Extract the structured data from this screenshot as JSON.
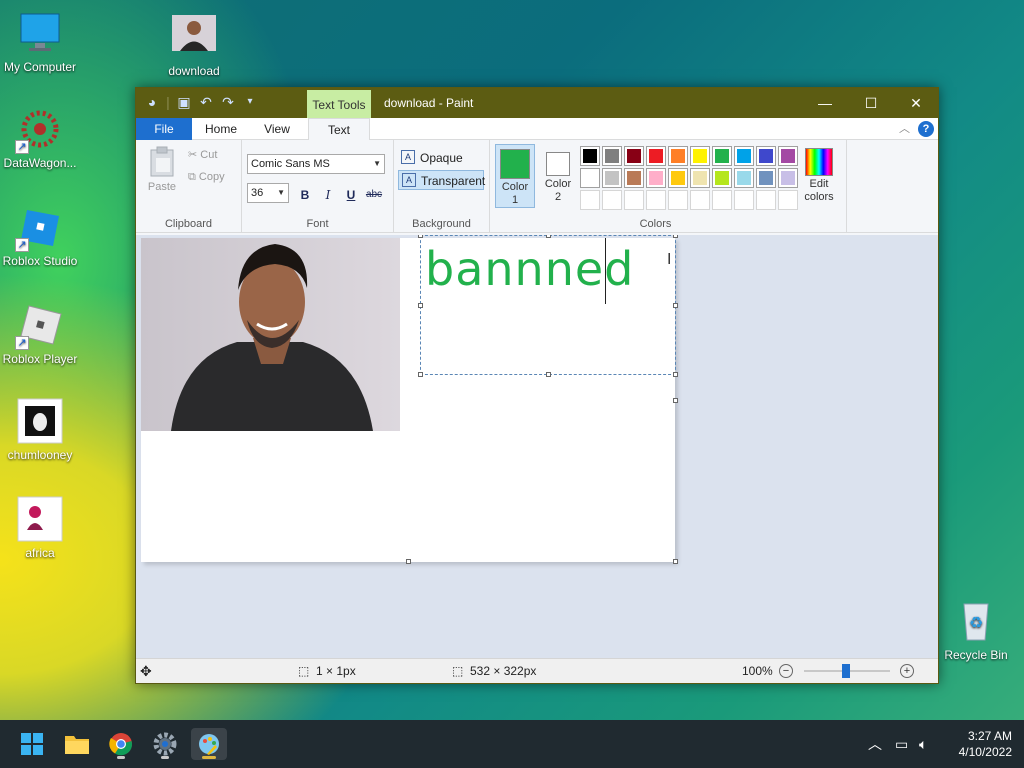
{
  "desktop": {
    "icons": [
      {
        "label": "My Computer"
      },
      {
        "label": "download"
      },
      {
        "label": "DataWagon..."
      },
      {
        "label": "Roblox Studio"
      },
      {
        "label": "Roblox Player"
      },
      {
        "label": "chumlooney"
      },
      {
        "label": "africa"
      },
      {
        "label": "Recycle Bin"
      }
    ]
  },
  "window": {
    "title": "download - Paint",
    "context_tab": "Text Tools",
    "tabs": [
      "File",
      "Home",
      "View",
      "Text"
    ],
    "active_tab": "Text"
  },
  "ribbon": {
    "clipboard": {
      "label": "Clipboard",
      "paste": "Paste",
      "cut": "Cut",
      "copy": "Copy"
    },
    "font": {
      "label": "Font",
      "family": "Comic Sans MS",
      "size": "36",
      "bold": "B",
      "italic": "I",
      "underline": "U",
      "strike": "abc"
    },
    "background": {
      "label": "Background",
      "opaque": "Opaque",
      "transparent": "Transparent",
      "selected": "Transparent"
    },
    "colors": {
      "label": "Colors",
      "color1_label": "Color 1",
      "color2_label": "Color 2",
      "color1": "#22b14c",
      "color2": "#ffffff",
      "edit_colors": "Edit colors",
      "palette_row1": [
        "#000000",
        "#7f7f7f",
        "#880015",
        "#ed1c24",
        "#ff7f27",
        "#fff200",
        "#22b14c",
        "#00a2e8",
        "#3f48cc",
        "#a349a4"
      ],
      "palette_row2": [
        "#ffffff",
        "#c3c3c3",
        "#b97a57",
        "#ffaec9",
        "#ffc90e",
        "#efe4b0",
        "#b5e61d",
        "#99d9ea",
        "#7092be",
        "#c8bfe7"
      ]
    }
  },
  "canvas": {
    "text": "bannned",
    "text_color": "#22b14c"
  },
  "status": {
    "cursor_size": "1 × 1px",
    "image_size": "532 × 322px",
    "zoom": "100%"
  },
  "taskbar": {
    "time": "3:27 AM",
    "date": "4/10/2022"
  }
}
